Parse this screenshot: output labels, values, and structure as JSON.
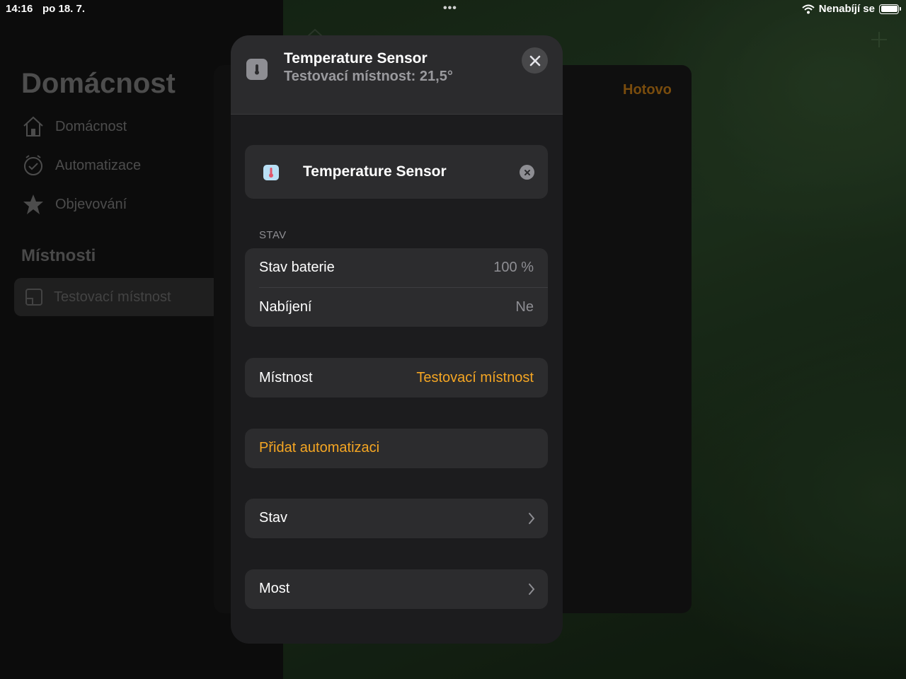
{
  "status_bar": {
    "time": "14:16",
    "date": "po 18. 7.",
    "charging_text": "Nenabíjí se"
  },
  "sidebar": {
    "title": "Domácnost",
    "items": [
      {
        "label": "Domácnost",
        "icon": "house-icon"
      },
      {
        "label": "Automatizace",
        "icon": "clock-check-icon"
      },
      {
        "label": "Objevování",
        "icon": "star-icon"
      }
    ],
    "rooms_title": "Místnosti",
    "rooms": [
      {
        "label": "Testovací místnost",
        "icon": "room-icon"
      }
    ]
  },
  "background_sheet": {
    "done_label": "Hotovo"
  },
  "modal": {
    "title": "Temperature Sensor",
    "subtitle": "Testovací místnost: 21,5°",
    "accessory_name": "Temperature Sensor",
    "status_header": "STAV",
    "status_rows": [
      {
        "label": "Stav baterie",
        "value": "100 %"
      },
      {
        "label": "Nabíjení",
        "value": "Ne"
      }
    ],
    "room_label": "Místnost",
    "room_value": "Testovací místnost",
    "add_automation_label": "Přidat automatizaci",
    "nav_rows": [
      {
        "label": "Stav"
      },
      {
        "label": "Most"
      }
    ]
  },
  "colors": {
    "accent": "#f5a623",
    "accent_dimmed": "#a86a12",
    "modal_bg": "#1c1c1e",
    "card_bg": "#2c2c2e",
    "secondary_text": "#8e8e93"
  }
}
